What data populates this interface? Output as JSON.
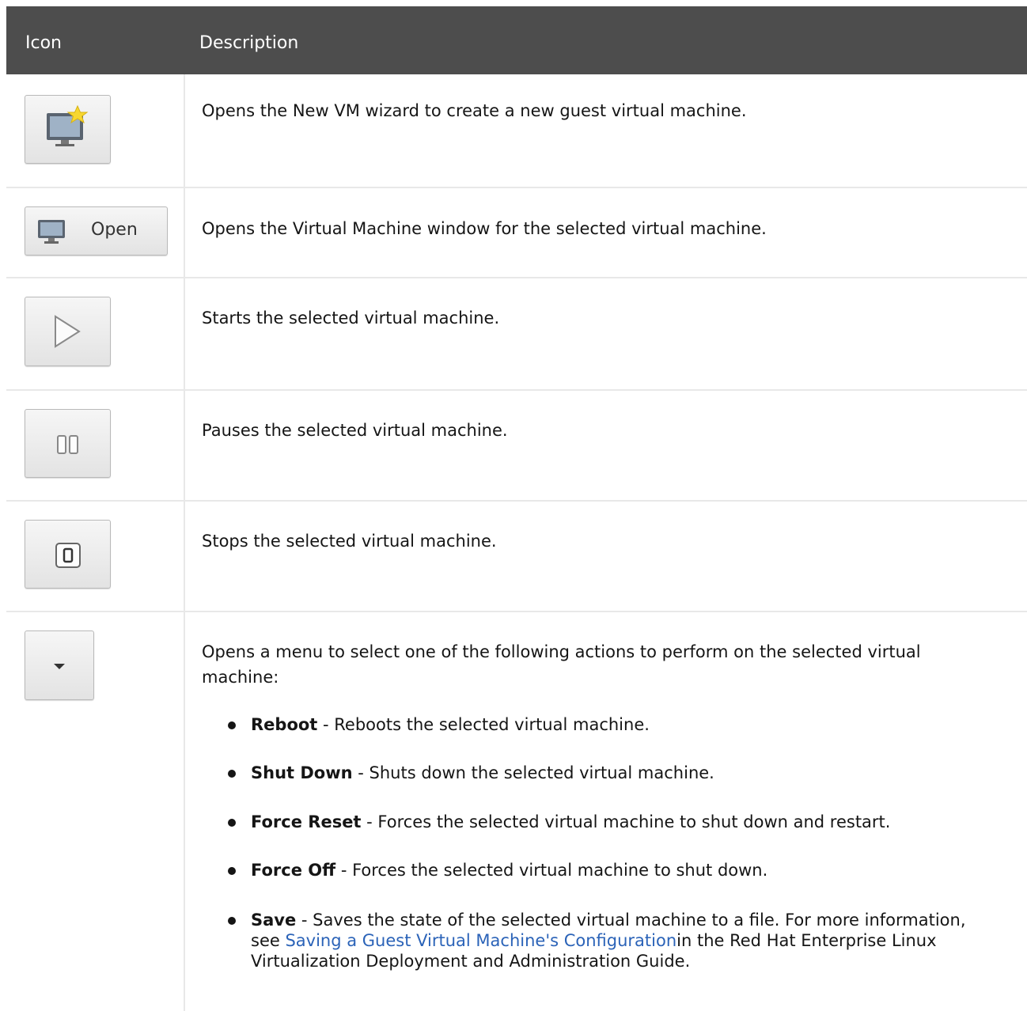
{
  "header": {
    "icon_col": "Icon",
    "desc_col": "Description"
  },
  "rows": [
    {
      "desc": "Opens the New VM wizard to create a new guest virtual machine."
    },
    {
      "button_label": "Open",
      "desc": "Opens the Virtual Machine window for the selected virtual machine."
    },
    {
      "desc": "Starts the selected virtual machine."
    },
    {
      "desc": "Pauses the selected virtual machine."
    },
    {
      "desc": "Stops the selected virtual machine."
    },
    {
      "desc_line1": "Opens a menu to select one of the following actions to perform on the selected virtual",
      "desc_line2": "machine:",
      "actions": [
        {
          "name": "Reboot",
          "text": " - Reboots the selected virtual machine."
        },
        {
          "name": "Shut Down",
          "text": " - Shuts down the selected virtual machine."
        },
        {
          "name": "Force Reset",
          "text": " - Forces the selected virtual machine to shut down and restart."
        },
        {
          "name": "Force Off",
          "text": " - Forces the selected virtual machine to shut down."
        },
        {
          "name": "Save",
          "text": " - Saves the state of the selected virtual machine to a file. For more information, see ",
          "link": "Saving a Guest Virtual Machine's Configuration",
          "after": "in the Red Hat Enterprise Linux Virtualization Deployment and Administration Guide."
        }
      ]
    }
  ],
  "icons": [
    "new-vm-icon",
    "monitor-icon",
    "play-icon",
    "pause-icon",
    "stop-icon",
    "dropdown-arrow-icon"
  ]
}
